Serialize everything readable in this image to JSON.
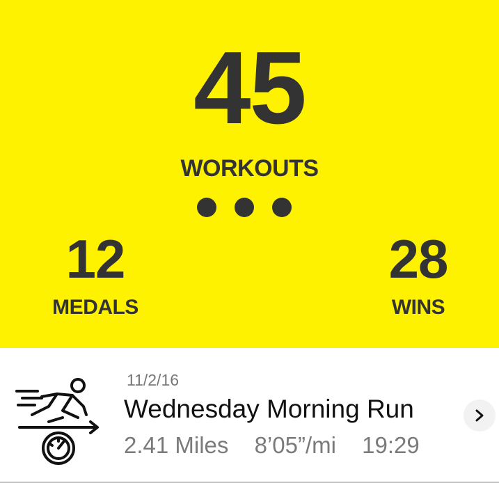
{
  "summary": {
    "workouts_count": "45",
    "workouts_label": "WORKOUTS",
    "medals_count": "12",
    "medals_label": "MEDALS",
    "wins_count": "28",
    "wins_label": "WINS"
  },
  "workout": {
    "date": "11/2/16",
    "title": "Wednesday Morning Run",
    "distance": "2.41 Miles",
    "pace": "8’05”/mi",
    "duration": "19:29",
    "icon": "runner-speedometer-icon"
  },
  "colors": {
    "hero_background": "#FFF200",
    "hero_text": "#333333"
  },
  "icons": {
    "more": "more-dots-icon",
    "chevron": "chevron-right-icon"
  }
}
